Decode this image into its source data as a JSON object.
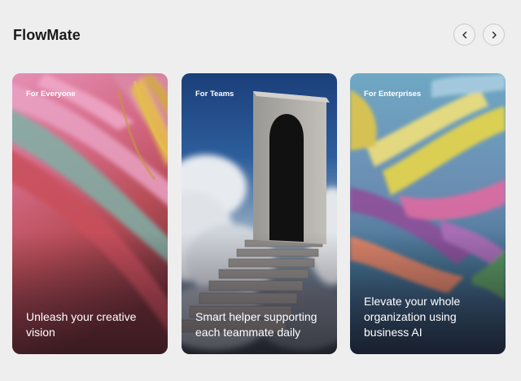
{
  "header": {
    "brand": "FlowMate",
    "prev_icon": "chevron-left-icon",
    "next_icon": "chevron-right-icon"
  },
  "cards": [
    {
      "tag": "For Everyone",
      "caption": "Unleash your creative vision",
      "image": "abstract pink and red paint strokes"
    },
    {
      "tag": "For Teams",
      "caption": "Smart helper supporting each teammate daily",
      "image": "stone arch doorway with staircase above clouds"
    },
    {
      "tag": "For Enterprises",
      "caption": "Elevate your whole organization using business AI",
      "image": "colorful abstract brushstrokes on blue"
    }
  ],
  "colors": {
    "background": "#eeeeee",
    "text": "#1a1a1a",
    "card_text": "#ffffff"
  }
}
